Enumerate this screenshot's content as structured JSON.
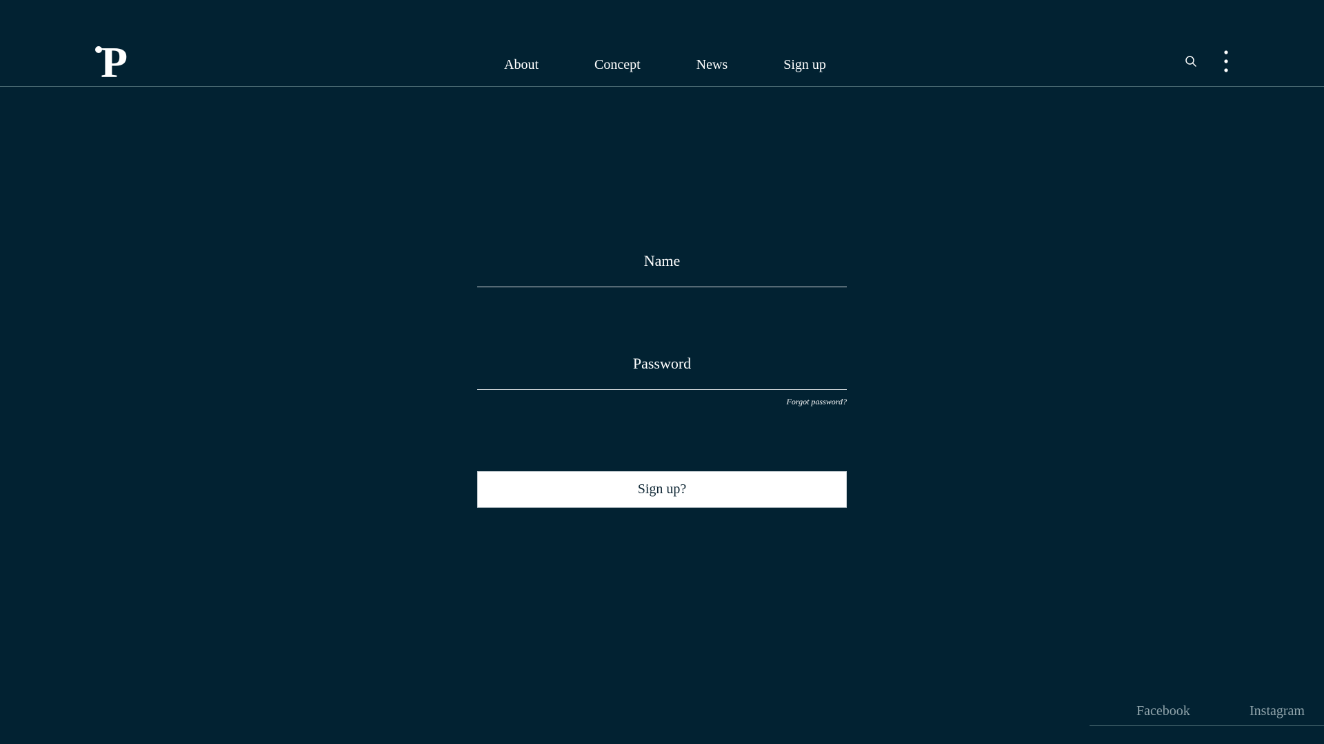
{
  "brand": {
    "logo_letter": "P"
  },
  "nav": {
    "items": [
      {
        "label": "About"
      },
      {
        "label": "Concept"
      },
      {
        "label": "News"
      },
      {
        "label": "Sign up"
      }
    ]
  },
  "header_icons": {
    "search": "search-icon",
    "menu": "more-vertical-icon"
  },
  "form": {
    "name_placeholder": "Name",
    "password_placeholder": "Password",
    "forgot_label": "Forgot password?",
    "submit_label": "Sign up?"
  },
  "social": {
    "facebook_label": "Facebook",
    "instagram_label": "Instagram"
  },
  "colors": {
    "background": "#022232",
    "foreground": "#ffffff",
    "muted": "#8fa3aa",
    "divider": "#4a6a72"
  }
}
